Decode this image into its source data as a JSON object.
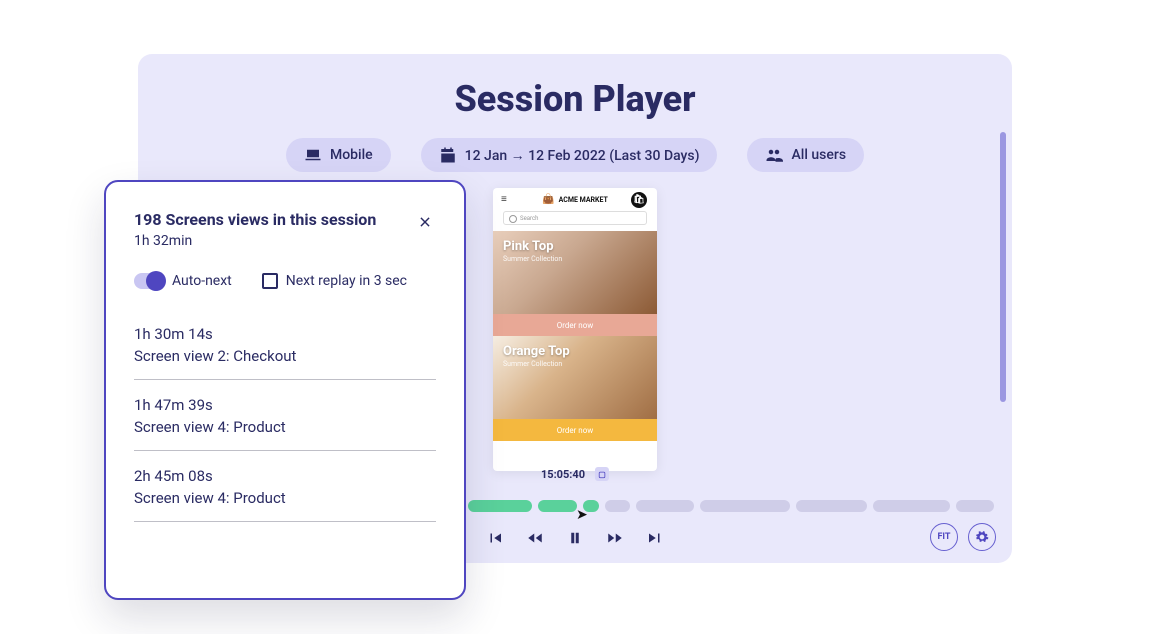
{
  "header": {
    "title": "Session Player"
  },
  "filters": {
    "device": "Mobile",
    "date_range": "12 Jan → 12 Feb 2022 (Last 30 Days)",
    "users": "All users"
  },
  "device_preview": {
    "brand": "ACME MARKET",
    "search_placeholder": "Search",
    "products": [
      {
        "name": "Pink Top",
        "subtitle": "Summer Collection",
        "cta": "Order now"
      },
      {
        "name": "Orange Top",
        "subtitle": "Summer Collection",
        "cta": "Order now"
      }
    ]
  },
  "playback": {
    "timecode": "15:05:40",
    "fit_label": "FIT"
  },
  "popover": {
    "title": "198 Screens views in this session",
    "duration": "1h 32min",
    "auto_next_label": "Auto-next",
    "next_replay_label": "Next replay in 3 sec",
    "entries": [
      {
        "time": "1h 30m 14s",
        "name": "Screen view 2: Checkout"
      },
      {
        "time": "1h 47m 39s",
        "name": "Screen view 4: Product"
      },
      {
        "time": "2h 45m 08s",
        "name": "Screen view 4: Product"
      }
    ]
  }
}
